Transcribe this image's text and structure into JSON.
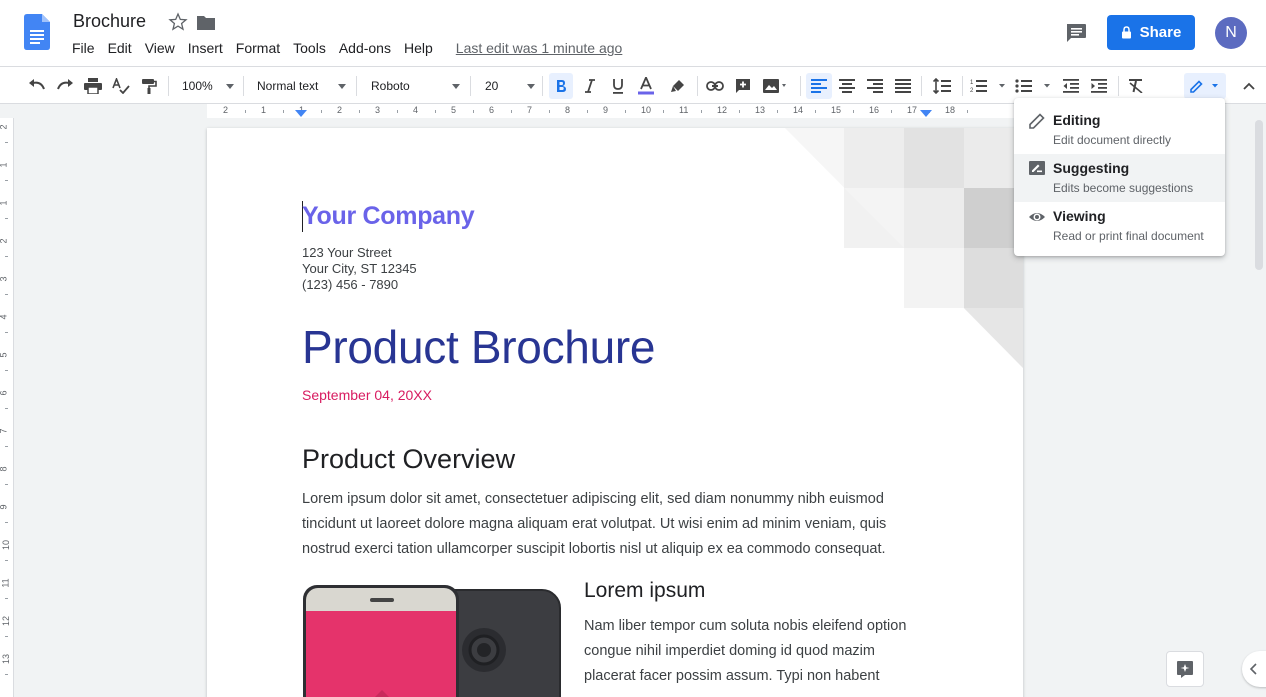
{
  "header": {
    "doc_title": "Brochure",
    "menu": [
      "File",
      "Edit",
      "View",
      "Insert",
      "Format",
      "Tools",
      "Add-ons",
      "Help"
    ],
    "last_edit": "Last edit was 1 minute ago",
    "share_label": "Share",
    "avatar_initial": "N"
  },
  "toolbar": {
    "zoom": "100%",
    "style": "Normal text",
    "font": "Roboto",
    "font_size": "20"
  },
  "ruler": {
    "marks": [
      "2",
      "1",
      "1",
      "2",
      "3",
      "4",
      "5",
      "6",
      "7",
      "8",
      "9",
      "10",
      "11",
      "12",
      "13",
      "14",
      "15",
      "16",
      "17",
      "18"
    ]
  },
  "vruler": {
    "marks": [
      "2",
      "1",
      "1",
      "2",
      "3",
      "4",
      "5",
      "6",
      "7",
      "8",
      "9",
      "10",
      "11",
      "12",
      "13"
    ]
  },
  "document": {
    "company": "Your Company",
    "address": [
      "123 Your Street",
      "Your City, ST 12345",
      "(123) 456 - 7890"
    ],
    "title": "Product Brochure",
    "date": "September 04, 20XX",
    "overview_heading": "Product Overview",
    "overview_lines": [
      "Lorem ipsum dolor sit amet, consectetuer adipiscing elit, sed diam nonummy nibh euismod",
      "tincidunt ut laoreet dolore magna aliquam erat volutpat. Ut wisi enim ad minim veniam, quis",
      "nostrud exerci tation ullamcorper suscipit lobortis nisl ut aliquip ex ea commodo consequat."
    ],
    "lorem_heading": "Lorem ipsum",
    "lorem_lines": [
      "Nam liber tempor cum soluta nobis eleifend option",
      "congue nihil imperdiet doming id quod mazim",
      "placerat facer possim assum. Typi non habent"
    ]
  },
  "mode_menu": {
    "items": [
      {
        "label": "Editing",
        "desc": "Edit document directly",
        "icon": "pencil-icon"
      },
      {
        "label": "Suggesting",
        "desc": "Edits become suggestions",
        "icon": "suggest-icon"
      },
      {
        "label": "Viewing",
        "desc": "Read or print final document",
        "icon": "eye-icon"
      }
    ],
    "selected": "Suggesting"
  },
  "colors": {
    "accent": "#1a73e8",
    "company": "#6a63e9",
    "title": "#283593",
    "date": "#d81b60",
    "phone_screen": "#e5336b"
  }
}
